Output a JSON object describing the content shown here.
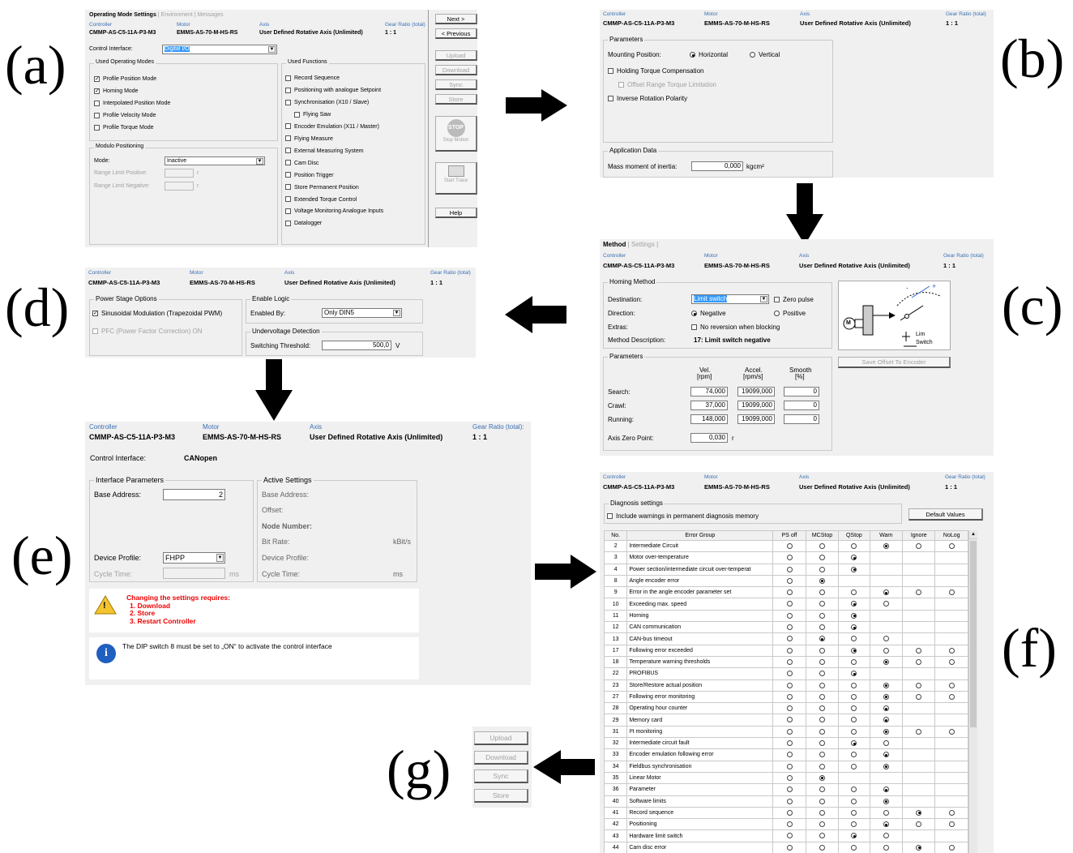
{
  "labels": {
    "a": "(a)",
    "b": "(b)",
    "c": "(c)",
    "d": "(d)",
    "e": "(e)",
    "f": "(f)",
    "g": "(g)"
  },
  "header": {
    "controller_label": "Controller",
    "motor_label": "Motor",
    "axis_label": "Axis",
    "gear_label": "Gear Ratio (total)",
    "gear_label_e": "Gear Ratio (total):",
    "controller": "CMMP-AS-C5-11A-P3-M3",
    "motor": "EMMS-AS-70-M-HS-RS",
    "axis": "User Defined Rotative Axis (Unlimited)",
    "gear": "1 : 1"
  },
  "panel_a": {
    "tabs": [
      "Operating Mode Settings",
      "Environment",
      "Messages"
    ],
    "control_interface_label": "Control Interface:",
    "control_interface": "Digital I/O",
    "used_modes_title": "Used Operating Modes",
    "modes": [
      {
        "label": "Profile Position Mode",
        "checked": true
      },
      {
        "label": "Homing Mode",
        "checked": true
      },
      {
        "label": "Interpolated Position Mode",
        "checked": false
      },
      {
        "label": "Profile Velocity Mode",
        "checked": false
      },
      {
        "label": "Profile Torque Mode",
        "checked": false
      }
    ],
    "modulo_title": "Modulo Positioning",
    "mode_label": "Mode:",
    "mode_value": "Inactive",
    "range_pos": "Range Limit Positive:",
    "range_neg": "Range Limit Negative:",
    "unit_r": "r",
    "used_functions_title": "Used Functions",
    "functions": [
      "Record Sequence",
      "Positioning with analogue Setpoint",
      "Synchronisation (X10 / Slave)",
      "Flying Saw",
      "Encoder Emulation (X11 / Master)",
      "Flying Measure",
      "External Measuring System",
      "Cam Disc",
      "Position Trigger",
      "Store Permanent Position",
      "Extended Torque Control",
      "Voltage Monitoring Analogue Inputs",
      "Datalogger"
    ],
    "buttons": {
      "next": "Next >",
      "previous": "< Previous",
      "upload": "Upload",
      "download": "Download",
      "sync": "Sync",
      "store": "Store",
      "stop": "Stop Motion",
      "trace": "Start Trace",
      "help": "Help"
    },
    "stop_icon": "STOP"
  },
  "panel_b": {
    "parameters_title": "Parameters",
    "mounting_label": "Mounting Position:",
    "horizontal": "Horizontal",
    "vertical": "Vertical",
    "holding": "Holding Torque Compensation",
    "offset": "Offset Range Torque Limitation",
    "inverse": "Inverse Rotation Polarity",
    "app_title": "Application Data",
    "mass_label": "Mass moment of inertia:",
    "mass_value": "0,000",
    "mass_unit": "kgcm²"
  },
  "panel_c": {
    "tabs": [
      "Method",
      "Settings"
    ],
    "homing_title": "Homing Method",
    "destination_label": "Destination:",
    "destination": "Limit switch",
    "zero_pulse": "Zero pulse",
    "direction_label": "Direction:",
    "negative": "Negative",
    "positive": "Positive",
    "extras_label": "Extras:",
    "no_reversion": "No reversion when blocking",
    "method_desc_label": "Method Description:",
    "method_desc": "17: Limit switch negative",
    "save_offset": "Save Offset To Encoder",
    "params_title": "Parameters",
    "col_vel": "Vel.",
    "col_vel_u": "[rpm]",
    "col_acc": "Accel.",
    "col_acc_u": "[rpm/s]",
    "col_smooth": "Smooth",
    "col_smooth_u": "[%]",
    "rows": [
      {
        "label": "Search:",
        "vel": "74,000",
        "acc": "19099,000",
        "smooth": "0"
      },
      {
        "label": "Crawl:",
        "vel": "37,000",
        "acc": "19099,000",
        "smooth": "0"
      },
      {
        "label": "Running:",
        "vel": "148,000",
        "acc": "19099,000",
        "smooth": "0"
      }
    ],
    "axis_zero_label": "Axis Zero Point:",
    "axis_zero": "0,030",
    "axis_zero_unit": "r",
    "diagram": {
      "m": "M",
      "lim": "Lim",
      "switch": "Switch",
      "minus": "-",
      "plus": "+"
    }
  },
  "panel_d": {
    "power_title": "Power Stage Options",
    "sinus": "Sinusoidal Modulation (Trapezoidal PWM)",
    "pfc": "PFC (Power Factor Correction) ON",
    "enable_title": "Enable Logic",
    "enabled_by_label": "Enabled By:",
    "enabled_by": "Only DIN5",
    "under_title": "Undervoltage Detection",
    "switching_label": "Switching Threshold:",
    "switching_value": "500,0",
    "switching_unit": "V"
  },
  "panel_e": {
    "control_interface_label": "Control Interface:",
    "control_interface": "CANopen",
    "iface_title": "Interface Parameters",
    "base_label": "Base Address:",
    "base_value": "2",
    "device_label": "Device Profile:",
    "device_value": "FHPP",
    "cycle_label": "Cycle Time:",
    "cycle_unit": "ms",
    "active_title": "Active Settings",
    "a_base": "Base Address:",
    "a_offset": "Offset:",
    "a_node": "Node Number:",
    "a_bitrate": "Bit Rate:",
    "a_bitrate_unit": "kBit/s",
    "a_device": "Device Profile:",
    "a_cycle": "Cycle Time:",
    "a_cycle_unit": "ms",
    "warn_title": "Changing the settings requires:",
    "warn_1": "1. Download",
    "warn_2": "2. Store",
    "warn_3": "3. Restart Controller",
    "info_text": "The DIP switch 8 must be set to „ON“ to activate the control interface",
    "warn_icon": "!",
    "info_icon": "i"
  },
  "panel_f": {
    "diag_title": "Diagnosis settings",
    "include_warnings": "Include warnings in permanent diagnosis memory",
    "default_values": "Default Values",
    "columns": [
      "No.",
      "Error Group",
      "PS off",
      "MCStop",
      "QStop",
      "Warn",
      "Ignore",
      "NoLog"
    ],
    "rows": [
      {
        "no": "2",
        "name": "Intermediate Circuit",
        "r": [
          0,
          0,
          0,
          1,
          0,
          0
        ]
      },
      {
        "no": "3",
        "name": "Motor over-temperature",
        "r": [
          0,
          0,
          1,
          null,
          null,
          null
        ]
      },
      {
        "no": "4",
        "name": "Power section/intermediate circuit over-temperat",
        "r": [
          0,
          0,
          1,
          null,
          null,
          null
        ]
      },
      {
        "no": "8",
        "name": "Angle encoder error",
        "r": [
          0,
          1,
          null,
          null,
          null,
          null
        ]
      },
      {
        "no": "9",
        "name": "Error in the angle encoder parameter set",
        "r": [
          0,
          0,
          0,
          1,
          0,
          0
        ]
      },
      {
        "no": "10",
        "name": "Exceeding max. speed",
        "r": [
          0,
          0,
          1,
          0,
          null,
          null
        ]
      },
      {
        "no": "11",
        "name": "Homing",
        "r": [
          0,
          0,
          1,
          null,
          null,
          null
        ]
      },
      {
        "no": "12",
        "name": "CAN communication",
        "r": [
          0,
          0,
          1,
          null,
          null,
          null
        ]
      },
      {
        "no": "13",
        "name": "CAN-bus timeout",
        "r": [
          0,
          1,
          0,
          0,
          null,
          null
        ]
      },
      {
        "no": "17",
        "name": "Following error exceeded",
        "r": [
          0,
          0,
          1,
          0,
          0,
          0
        ]
      },
      {
        "no": "18",
        "name": "Temperature warning thresholds",
        "r": [
          0,
          0,
          0,
          1,
          0,
          0
        ]
      },
      {
        "no": "22",
        "name": "PROFIBUS",
        "r": [
          0,
          0,
          1,
          null,
          null,
          null
        ]
      },
      {
        "no": "23",
        "name": "Store/Restore actual position",
        "r": [
          0,
          0,
          0,
          1,
          0,
          0
        ]
      },
      {
        "no": "27",
        "name": "Following error monitoring",
        "r": [
          0,
          0,
          0,
          1,
          0,
          0
        ]
      },
      {
        "no": "28",
        "name": "Operating hour counter",
        "r": [
          0,
          0,
          0,
          1,
          null,
          null
        ]
      },
      {
        "no": "29",
        "name": "Memory card",
        "r": [
          0,
          0,
          0,
          1,
          null,
          null
        ]
      },
      {
        "no": "31",
        "name": "I²t monitoring",
        "r": [
          0,
          0,
          0,
          1,
          0,
          0
        ]
      },
      {
        "no": "32",
        "name": "Intermediate circuit fault",
        "r": [
          0,
          0,
          1,
          0,
          null,
          null
        ]
      },
      {
        "no": "33",
        "name": "Encoder emulation following error",
        "r": [
          0,
          0,
          0,
          1,
          null,
          null
        ]
      },
      {
        "no": "34",
        "name": "Fieldbus synchronisation",
        "r": [
          0,
          0,
          0,
          1,
          null,
          null
        ]
      },
      {
        "no": "35",
        "name": "Linear Motor",
        "r": [
          0,
          1,
          null,
          null,
          null,
          null
        ]
      },
      {
        "no": "36",
        "name": "Parameter",
        "r": [
          0,
          0,
          0,
          1,
          null,
          null
        ]
      },
      {
        "no": "40",
        "name": "Software limits",
        "r": [
          0,
          0,
          0,
          1,
          null,
          null
        ]
      },
      {
        "no": "41",
        "name": "Record sequence",
        "r": [
          0,
          0,
          0,
          0,
          1,
          0
        ]
      },
      {
        "no": "42",
        "name": "Positioning",
        "r": [
          0,
          0,
          0,
          1,
          0,
          0
        ]
      },
      {
        "no": "43",
        "name": "Hardware limit switch",
        "r": [
          0,
          0,
          1,
          0,
          null,
          null
        ]
      },
      {
        "no": "44",
        "name": "Cam disc error",
        "r": [
          0,
          0,
          0,
          0,
          1,
          0
        ]
      }
    ]
  },
  "panel_g": {
    "upload": "Upload",
    "download": "Download",
    "sync": "Sync",
    "store": "Store"
  }
}
